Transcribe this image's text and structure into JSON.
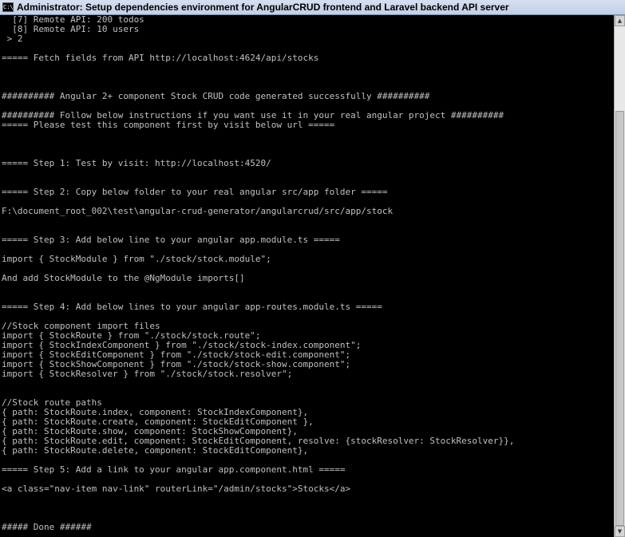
{
  "window": {
    "title": "Administrator:  Setup dependencies environment for AngularCRUD frontend and Laravel backend API server",
    "icon": "cmd-icon",
    "icon_glyph": "C:\\"
  },
  "console": {
    "lines": [
      "  [7] Remote API: 200 todos",
      "  [8] Remote API: 10 users",
      " > 2",
      "",
      "===== Fetch fields from API http://localhost:4624/api/stocks",
      "",
      "",
      "",
      "########## Angular 2+ component Stock CRUD code generated successfully ##########",
      "",
      "########## Follow below instructions if you want use it in your real angular project ##########",
      "===== Please test this component first by visit below url =====",
      "",
      "",
      "",
      "===== Step 1: Test by visit: http://localhost:4520/",
      "",
      "",
      "===== Step 2: Copy below folder to your real angular src/app folder =====",
      "",
      "F:\\document_root_002\\test\\angular-crud-generator/angularcrud/src/app/stock",
      "",
      "",
      "===== Step 3: Add below line to your angular app.module.ts =====",
      "",
      "import { StockModule } from \"./stock/stock.module\";",
      "",
      "And add StockModule to the @NgModule imports[]",
      "",
      "",
      "===== Step 4: Add below lines to your angular app-routes.module.ts =====",
      "",
      "//Stock component import files",
      "import { StockRoute } from \"./stock/stock.route\";",
      "import { StockIndexComponent } from \"./stock/stock-index.component\";",
      "import { StockEditComponent } from \"./stock/stock-edit.component\";",
      "import { StockShowComponent } from \"./stock/stock-show.component\";",
      "import { StockResolver } from \"./stock/stock.resolver\";",
      "",
      "",
      "//Stock route paths",
      "{ path: StockRoute.index, component: StockIndexComponent},",
      "{ path: StockRoute.create, component: StockEditComponent },",
      "{ path: StockRoute.show, component: StockShowComponent},",
      "{ path: StockRoute.edit, component: StockEditComponent, resolve: {stockResolver: StockResolver}},",
      "{ path: StockRoute.delete, component: StockEditComponent},",
      "",
      "===== Step 5: Add a link to your angular app.component.html =====",
      "",
      "<a class=\"nav-item nav-link\" routerLink=\"/admin/stocks\">Stocks</a>",
      "",
      "",
      "",
      "##### Done ######"
    ]
  },
  "scrollbar": {
    "up_glyph": "▲",
    "down_glyph": "▼"
  }
}
